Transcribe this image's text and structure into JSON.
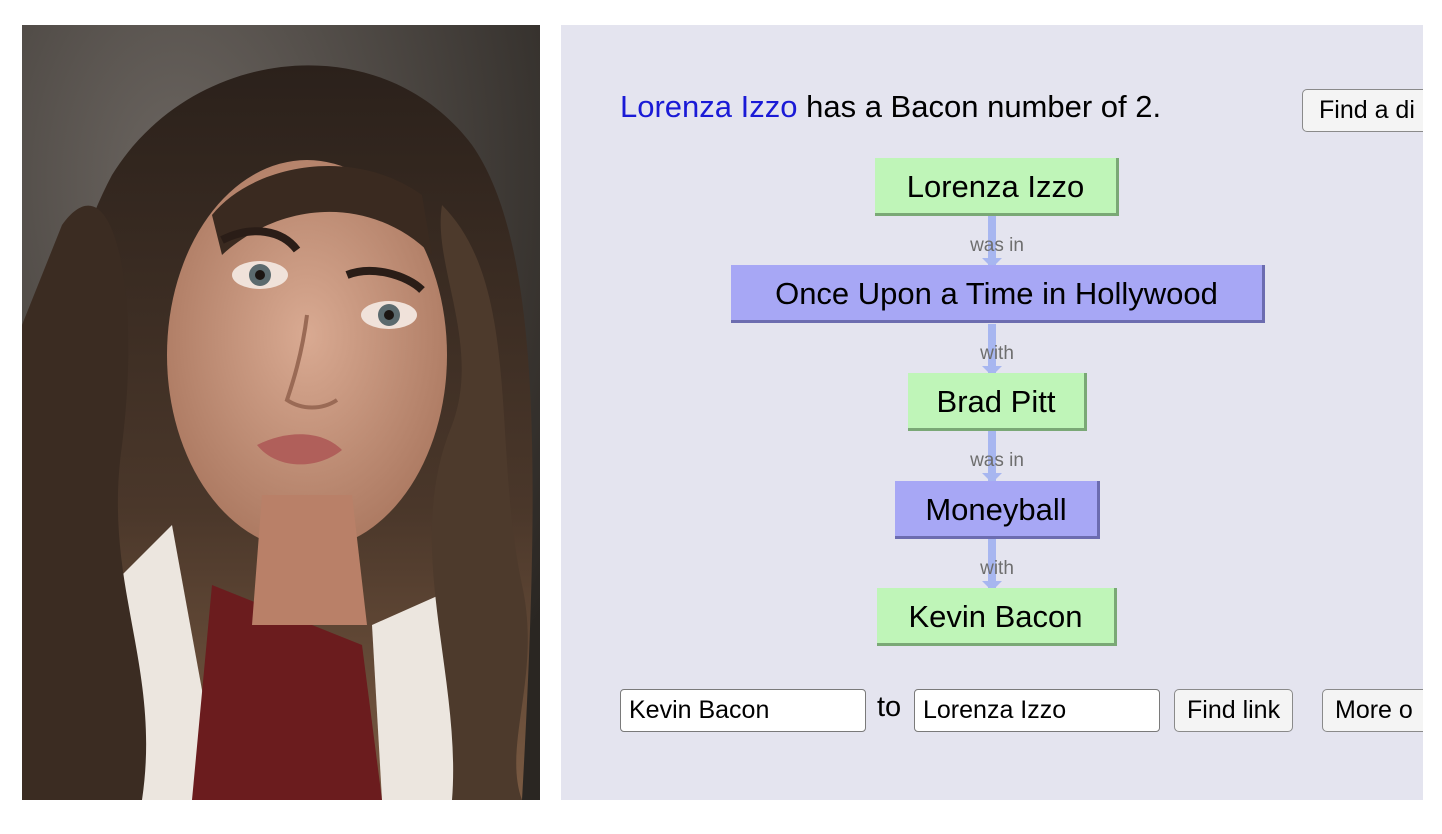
{
  "result": {
    "actor_link": "Lorenza Izzo",
    "sentence_rest": " has a Bacon number of 2.",
    "discover_button": "Find a di"
  },
  "chain": {
    "nodes": [
      {
        "label": "Lorenza Izzo",
        "kind": "person"
      },
      {
        "label": "Once Upon a Time in Hollywood",
        "kind": "movie"
      },
      {
        "label": "Brad Pitt",
        "kind": "person"
      },
      {
        "label": "Moneyball",
        "kind": "movie"
      },
      {
        "label": "Kevin Bacon",
        "kind": "person"
      }
    ],
    "edges": [
      "was in",
      "with",
      "was in",
      "with"
    ]
  },
  "search": {
    "from_value": "Kevin Bacon",
    "to_word": "to",
    "to_value": "Lorenza Izzo",
    "find_button": "Find link",
    "more_button": "More o"
  },
  "colors": {
    "person_node": "#bff5b8",
    "movie_node": "#a7a7f5",
    "link": "#1a1ad6",
    "panel_bg": "#e4e4ef"
  }
}
